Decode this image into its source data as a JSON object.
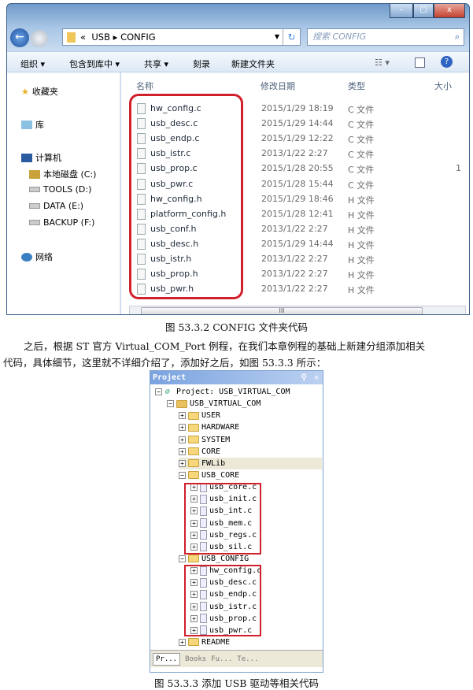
{
  "explorer": {
    "window_buttons": {
      "minimize": "–",
      "maximize": "□",
      "close": "x"
    },
    "breadcrumb": [
      "«",
      "USB",
      "CONFIG"
    ],
    "search_placeholder": "搜索 CONFIG",
    "toolbar": {
      "organize": "组织 ▾",
      "include_library": "包含到库中 ▾",
      "share": "共享 ▾",
      "burn": "刻录",
      "new_folder": "新建文件夹"
    },
    "nav": {
      "favorites": "收藏夹",
      "libraries": "库",
      "computer": "计算机",
      "drives": [
        "本地磁盘 (C:)",
        "TOOLS (D:)",
        "DATA (E:)",
        "BACKUP (F:)"
      ],
      "network": "网络"
    },
    "columns": {
      "name": "名称",
      "date": "修改日期",
      "type": "类型",
      "size": "大小"
    },
    "files": [
      {
        "name": "hw_config.c",
        "date": "2015/1/29 18:19",
        "type": "C 文件",
        "size": ""
      },
      {
        "name": "usb_desc.c",
        "date": "2015/1/29 14:44",
        "type": "C 文件",
        "size": ""
      },
      {
        "name": "usb_endp.c",
        "date": "2015/1/29 12:22",
        "type": "C 文件",
        "size": ""
      },
      {
        "name": "usb_istr.c",
        "date": "2013/1/22 2:27",
        "type": "C 文件",
        "size": ""
      },
      {
        "name": "usb_prop.c",
        "date": "2015/1/28 20:55",
        "type": "C 文件",
        "size": "1"
      },
      {
        "name": "usb_pwr.c",
        "date": "2015/1/28 15:44",
        "type": "C 文件",
        "size": ""
      },
      {
        "name": "hw_config.h",
        "date": "2015/1/29 18:46",
        "type": "H 文件",
        "size": ""
      },
      {
        "name": "platform_config.h",
        "date": "2015/1/28 12:41",
        "type": "H 文件",
        "size": ""
      },
      {
        "name": "usb_conf.h",
        "date": "2013/1/22 2:27",
        "type": "H 文件",
        "size": ""
      },
      {
        "name": "usb_desc.h",
        "date": "2015/1/29 14:44",
        "type": "H 文件",
        "size": ""
      },
      {
        "name": "usb_istr.h",
        "date": "2013/1/22 2:27",
        "type": "H 文件",
        "size": ""
      },
      {
        "name": "usb_prop.h",
        "date": "2013/1/22 2:27",
        "type": "H 文件",
        "size": ""
      },
      {
        "name": "usb_pwr.h",
        "date": "2013/1/22 2:27",
        "type": "H 文件",
        "size": ""
      }
    ],
    "scroll_thumb": "III"
  },
  "caption1": "图 53.3.2 CONFIG 文件夹代码",
  "paragraph": [
    "之后，根据 ST 官方 Virtual_COM_Port 例程，在我们本章例程的基础上新建分组添加相关",
    "代码，具体细节，这里就不详细介绍了，添加好之后，如图 53.3.3 所示："
  ],
  "project": {
    "title": "Project",
    "tree": [
      {
        "label": "Project: USB_VIRTUAL_COM",
        "level": 0,
        "kind": "project",
        "expanded": true
      },
      {
        "label": "USB_VIRTUAL_COM",
        "level": 1,
        "kind": "target",
        "expanded": true
      },
      {
        "label": "USER",
        "level": 2,
        "kind": "folder"
      },
      {
        "label": "HARDWARE",
        "level": 2,
        "kind": "folder"
      },
      {
        "label": "SYSTEM",
        "level": 2,
        "kind": "folder"
      },
      {
        "label": "CORE",
        "level": 2,
        "kind": "folder"
      },
      {
        "label": "FWLib",
        "level": 2,
        "kind": "folder",
        "selected": true
      },
      {
        "label": "USB_CORE",
        "level": 2,
        "kind": "folder",
        "expanded": true
      },
      {
        "label": "usb_core.c",
        "level": 3,
        "kind": "file"
      },
      {
        "label": "usb_init.c",
        "level": 3,
        "kind": "file"
      },
      {
        "label": "usb_int.c",
        "level": 3,
        "kind": "file"
      },
      {
        "label": "usb_mem.c",
        "level": 3,
        "kind": "file"
      },
      {
        "label": "usb_regs.c",
        "level": 3,
        "kind": "file"
      },
      {
        "label": "usb_sil.c",
        "level": 3,
        "kind": "file"
      },
      {
        "label": "USB_CONFIG",
        "level": 2,
        "kind": "folder",
        "expanded": true
      },
      {
        "label": "hw_config.c",
        "level": 3,
        "kind": "file"
      },
      {
        "label": "usb_desc.c",
        "level": 3,
        "kind": "file"
      },
      {
        "label": "usb_endp.c",
        "level": 3,
        "kind": "file"
      },
      {
        "label": "usb_istr.c",
        "level": 3,
        "kind": "file"
      },
      {
        "label": "usb_prop.c",
        "level": 3,
        "kind": "file"
      },
      {
        "label": "usb_pwr.c",
        "level": 3,
        "kind": "file"
      },
      {
        "label": "README",
        "level": 2,
        "kind": "folder"
      }
    ],
    "tabs": [
      "Pr...",
      "Books",
      "Fu...",
      "Te..."
    ]
  },
  "caption2": "图 53.3.3 添加 USB 驱动等相关代码",
  "colors": {
    "highlight": "#d0202b",
    "title_bar": "#7aa3df"
  }
}
